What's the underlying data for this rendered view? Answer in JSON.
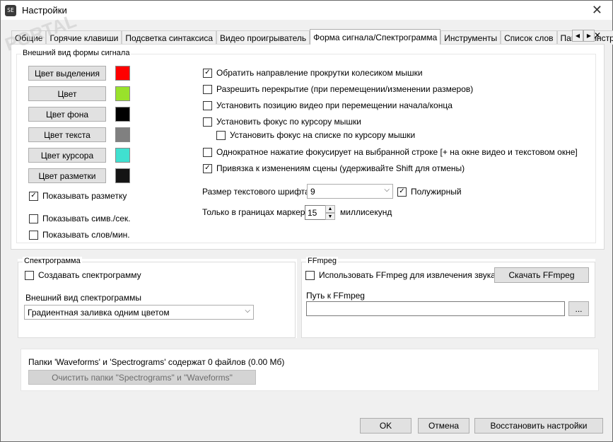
{
  "window": {
    "title": "Настройки",
    "app_icon": "SE",
    "close_glyph": "✕"
  },
  "tabs": [
    {
      "label": "Общие",
      "active": false
    },
    {
      "label": "Горячие клавиши",
      "active": false
    },
    {
      "label": "Подсветка синтаксиса",
      "active": false
    },
    {
      "label": "Видео проигрыватель",
      "active": false
    },
    {
      "label": "Форма сигнала/Спектрограмма",
      "active": true
    },
    {
      "label": "Инструменты",
      "active": false
    },
    {
      "label": "Список слов",
      "active": false
    },
    {
      "label": "Панель инстру",
      "active": false
    }
  ],
  "tab_scroll": {
    "left": "◀",
    "right": "▶",
    "close": "✕"
  },
  "waveform": {
    "group_label": "Внешний вид формы сигнала",
    "colors": [
      {
        "label": "Цвет выделения",
        "color": "#ff0000"
      },
      {
        "label": "Цвет",
        "color": "#99e22b"
      },
      {
        "label": "Цвет фона",
        "color": "#000000"
      },
      {
        "label": "Цвет текста",
        "color": "#808080"
      },
      {
        "label": "Цвет курсора",
        "color": "#40e0d0"
      },
      {
        "label": "Цвет разметки",
        "color": "#141414"
      }
    ],
    "show_marking": {
      "label": "Показывать разметку",
      "checked": true
    },
    "show_cps": {
      "label": "Показывать симв./сек.",
      "checked": false
    },
    "show_wpm": {
      "label": "Показывать слов/мин.",
      "checked": false
    }
  },
  "options": [
    {
      "label": "Обратить направление прокрутки колесиком мышки",
      "checked": true
    },
    {
      "label": "Разрешить перекрытие (при перемещении/изменении размеров)",
      "checked": false
    },
    {
      "label": "Установить позицию видео при перемещении начала/конца",
      "checked": false
    },
    {
      "label": "Установить фокус по курсору мышки",
      "checked": false
    },
    {
      "label": "Установить фокус на списке по курсору мышки",
      "checked": false
    },
    {
      "label": "Однократное нажатие фокусирует на выбранной строке [+ на окне видео и текстовом окне]",
      "checked": false
    },
    {
      "label": "Привязка к изменениям сцены (удерживайте Shift для отмены)",
      "checked": true
    }
  ],
  "font_size": {
    "label": "Размер текстового шрифта",
    "value": "9",
    "bold_label": "Полужирный",
    "bold_checked": true
  },
  "marker": {
    "label": "Только в границах маркера",
    "value": "15",
    "unit": "миллисекунд"
  },
  "spectrogram": {
    "group_label": "Спектрограмма",
    "create": {
      "label": "Создавать спектрограмму",
      "checked": false
    },
    "appearance_label": "Внешний вид спектрограммы",
    "appearance_value": "Градиентная заливка одним цветом"
  },
  "ffmpeg": {
    "group_label": "FFmpeg",
    "use": {
      "label": "Использовать FFmpeg для извлечения звука",
      "checked": false
    },
    "download_label": "Скачать FFmpeg",
    "path_label": "Путь к FFmpeg",
    "path_value": "",
    "browse_label": "..."
  },
  "folders": {
    "info": "Папки 'Waveforms' и 'Spectrograms' содержат 0 файлов (0.00 Мб)",
    "clear_label": "Очистить папки \"Spectrograms\" и \"Waveforms\""
  },
  "footer": {
    "ok": "OK",
    "cancel": "Отмена",
    "restore": "Восстановить настройки"
  },
  "watermark": "PORTAL"
}
